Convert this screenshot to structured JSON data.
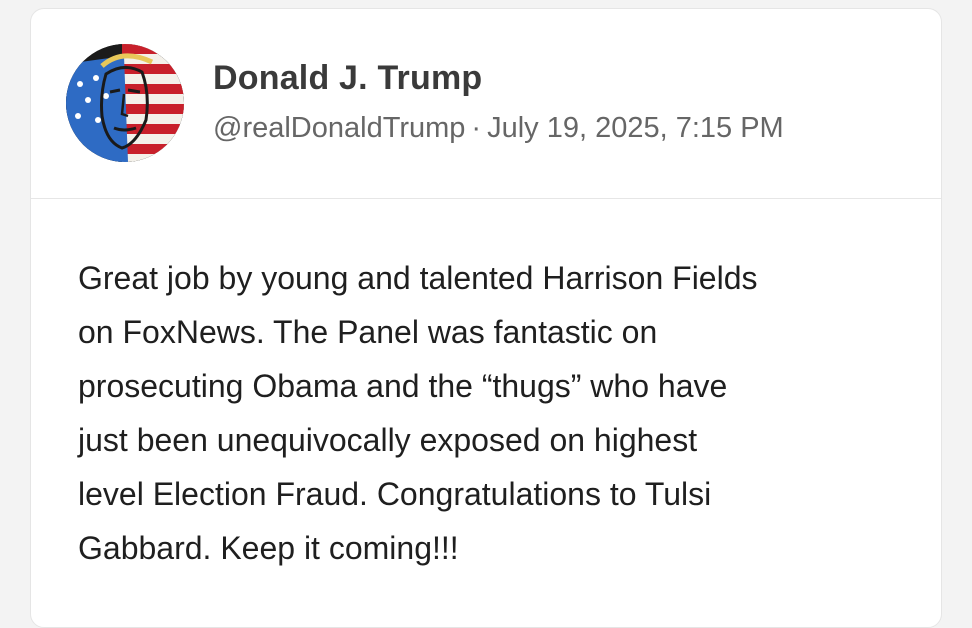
{
  "post": {
    "author": {
      "display_name": "Donald J. Trump",
      "handle": "@realDonaldTrump",
      "avatar_icon": "flag-portrait-avatar"
    },
    "separator": "·",
    "timestamp": "July 19, 2025, 7:15 PM",
    "text": "Great job by young and talented Harrison Fields\non FoxNews. The Panel was fantastic on\nprosecuting Obama and the “thugs” who have\njust been unequivocally exposed on highest\nlevel Election Fraud. Congratulations to Tulsi\nGabbard. Keep it coming!!!"
  },
  "colors": {
    "name": "#3a3a3a",
    "meta": "#666666",
    "body": "#1f1f1f",
    "flag_red": "#c8202b",
    "flag_blue": "#2e6bc4"
  }
}
